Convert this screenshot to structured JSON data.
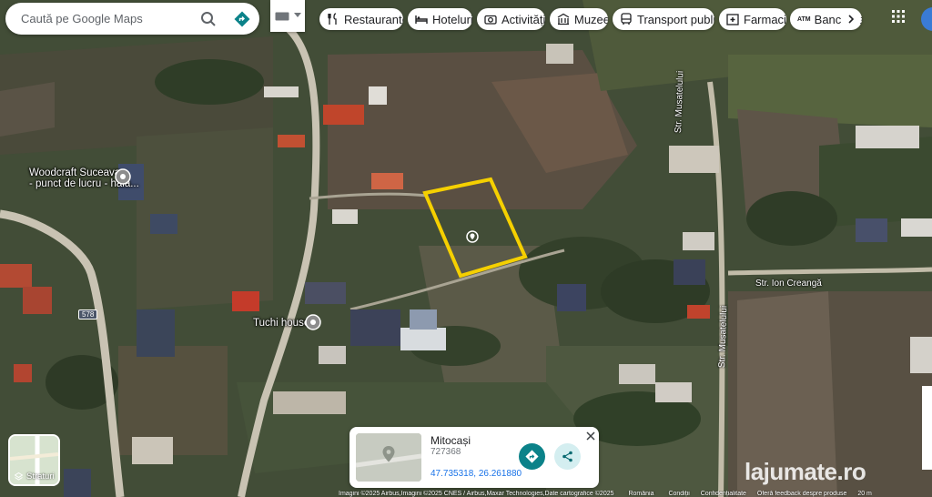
{
  "search": {
    "placeholder": "Caută pe Google Maps"
  },
  "chips": [
    {
      "label": "Restaurante",
      "icon": "fork-knife-icon"
    },
    {
      "label": "Hoteluri",
      "icon": "bed-icon"
    },
    {
      "label": "Activități",
      "icon": "camera-icon"
    },
    {
      "label": "Muzee",
      "icon": "museum-icon"
    },
    {
      "label": "Transport public",
      "icon": "bus-icon"
    },
    {
      "label": "Farmacii",
      "icon": "pharmacy-icon"
    },
    {
      "label": "Bancomate",
      "icon": "atm-icon",
      "prefix": "ATM"
    }
  ],
  "map_labels": {
    "poi1_line1": "Woodcraft Suceava",
    "poi1_line2": "- punct de lucru -  hala...",
    "poi2": "Tuchi house",
    "street1": "Str. Musatelului",
    "street1_lower": "Str. Musatelului",
    "street2": "Str. Ion Creangă",
    "route": "578"
  },
  "layers": {
    "label": "Straturi"
  },
  "place_card": {
    "title": "Mitocași",
    "code": "727368",
    "coords": "47.735318, 26.261880"
  },
  "footer": {
    "attribution": "Imagini ©2025 Airbus,Imagini ©2025 CNES / Airbus,Maxar Technologies,Date cartografice ©2025",
    "country": "România",
    "terms": "Condiții",
    "privacy": "Confidențialitate",
    "feedback": "Oferă feedback despre produse",
    "scale": "20 m"
  },
  "watermark": {
    "text": "lajumate.ro"
  },
  "colors": {
    "parcel_outline": "#f5d000",
    "direction_button": "#0b8289",
    "link_blue": "#1a73e8"
  }
}
